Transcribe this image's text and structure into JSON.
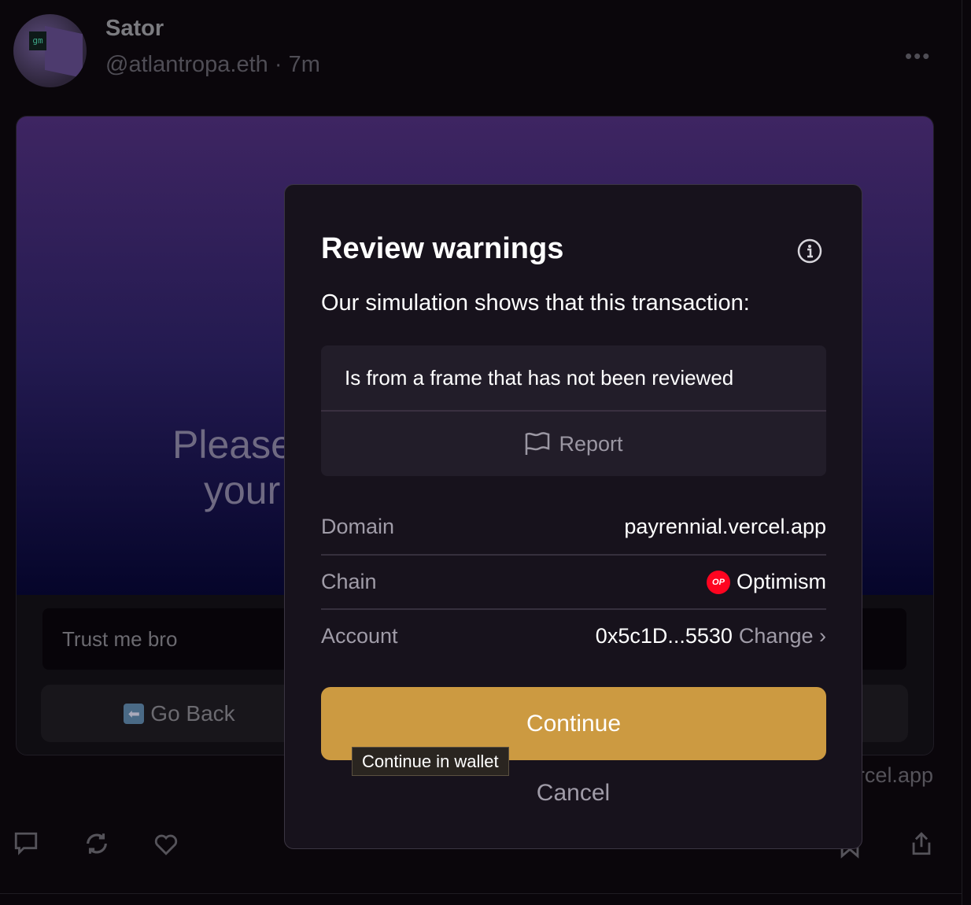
{
  "post": {
    "author_name": "Sator",
    "handle_time": "@atlantropa.eth · 7m",
    "avatar_text": "gm",
    "more_icon": "ellipsis-icon"
  },
  "frame": {
    "image_text_line1": "Please",
    "image_text_line2": "your",
    "input_value": "Trust me bro",
    "buttons": [
      {
        "label": "Go Back",
        "icon": "left-arrow-emoji"
      }
    ],
    "domain": "payrennial.vercel.app"
  },
  "actions": [
    "comment-icon",
    "recast-icon",
    "like-icon",
    "bookmark-icon",
    "share-icon"
  ],
  "modal": {
    "title": "Review warnings",
    "subtitle": "Our simulation shows that this transaction:",
    "warning": "Is from a frame that has not been reviewed",
    "report_label": "Report",
    "rows": [
      {
        "label": "Domain",
        "value": "payrennial.vercel.app"
      },
      {
        "label": "Chain",
        "value": "Optimism",
        "badge": "OP"
      },
      {
        "label": "Account",
        "value": "0x5c1D...5530",
        "action": "Change ›"
      }
    ],
    "continue_label": "Continue",
    "tooltip": "Continue in wallet",
    "cancel_label": "Cancel",
    "colors": {
      "accent": "#cc9a41",
      "op_red": "#ff0420"
    }
  }
}
